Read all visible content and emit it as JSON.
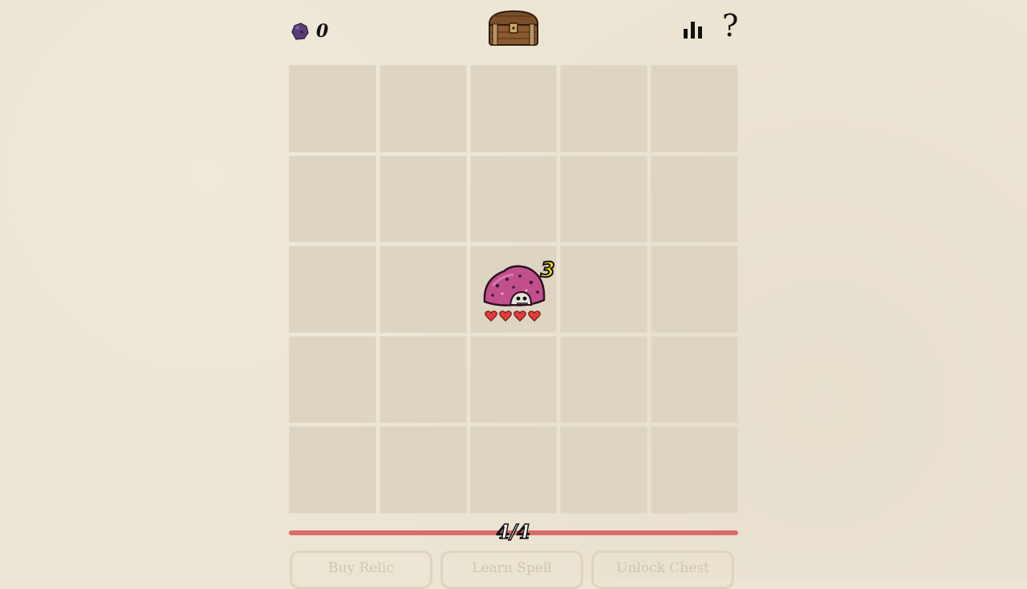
{
  "header": {
    "gem_count": "0",
    "gem_icon": "purple-gem-icon",
    "chest_icon": "treasure-chest-icon",
    "stats_icon": "bar-chart-icon",
    "help_label": "?"
  },
  "board": {
    "rows": 5,
    "cols": 5,
    "monster": {
      "row": 3,
      "col": 3,
      "icon": "pink-mushroom-creature-icon",
      "level": "3",
      "hearts": 4
    }
  },
  "player": {
    "hp_text": "4/4",
    "hp_fraction": 1.0,
    "hp_color": "#d96b6b"
  },
  "actions": {
    "buy_relic": "Buy Relic",
    "learn_spell": "Learn Spell",
    "unlock_chest": "Unlock Chest"
  }
}
